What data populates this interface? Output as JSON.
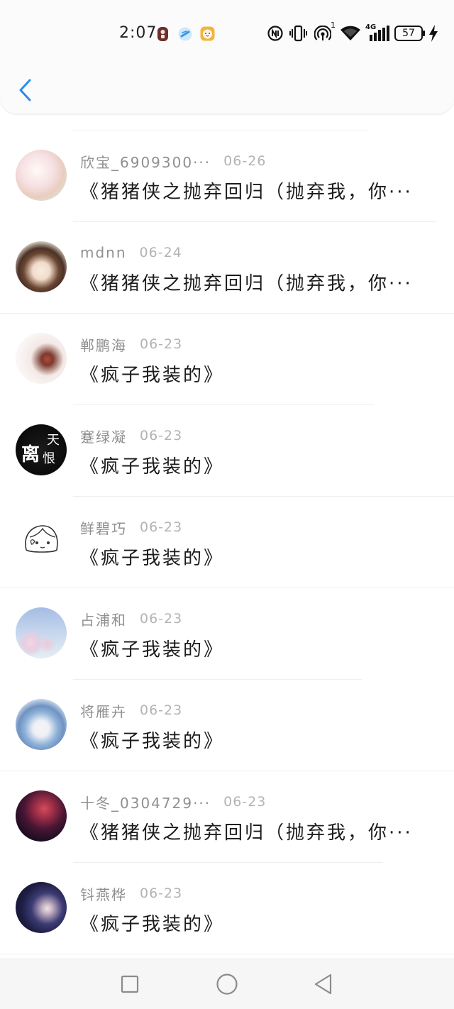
{
  "status_bar": {
    "time": "2:07",
    "app_icons": [
      "recorder-app-icon",
      "browser-app-icon",
      "face-app-icon"
    ],
    "status_icons": [
      "nfc-icon",
      "vibrate-icon",
      "hotspot-icon",
      "wifi-icon",
      "signal-icon",
      "battery-icon",
      "charging-icon"
    ],
    "hotspot_badge": "1",
    "network_type": "4G",
    "battery_level": "57"
  },
  "header": {
    "back_icon": "chevron-left-icon"
  },
  "colors": {
    "accent": "#2a8cf0",
    "name": "#8f8f8f",
    "date": "#b3b3b3",
    "title": "#1b1b1b",
    "divider": "#eeeeee",
    "nav_bar": "#f6f6f6"
  },
  "items": [
    {
      "name": "欣宝_6909300···",
      "date": "06-26",
      "title": "《猪猪侠之抛弃回归（抛弃我，你···"
    },
    {
      "name": "mdnn",
      "date": "06-24",
      "title": "《猪猪侠之抛弃回归（抛弃我，你···"
    },
    {
      "name": "郸鹏海",
      "date": "06-23",
      "title": "《疯子我装的》"
    },
    {
      "name": "蹇绿凝",
      "date": "06-23",
      "title": "《疯子我装的》",
      "avatar_text": [
        "离",
        "恨",
        "天"
      ]
    },
    {
      "name": "鲜碧巧",
      "date": "06-23",
      "title": "《疯子我装的》"
    },
    {
      "name": "占浦和",
      "date": "06-23",
      "title": "《疯子我装的》"
    },
    {
      "name": "将雁卉",
      "date": "06-23",
      "title": "《疯子我装的》"
    },
    {
      "name": "十冬_0304729···",
      "date": "06-23",
      "title": "《猪猪侠之抛弃回归（抛弃我，你···"
    },
    {
      "name": "钭燕桦",
      "date": "06-23",
      "title": "《疯子我装的》"
    }
  ],
  "nav_bar": {
    "icons": [
      "recents-square-icon",
      "home-circle-icon",
      "back-triangle-icon"
    ]
  }
}
